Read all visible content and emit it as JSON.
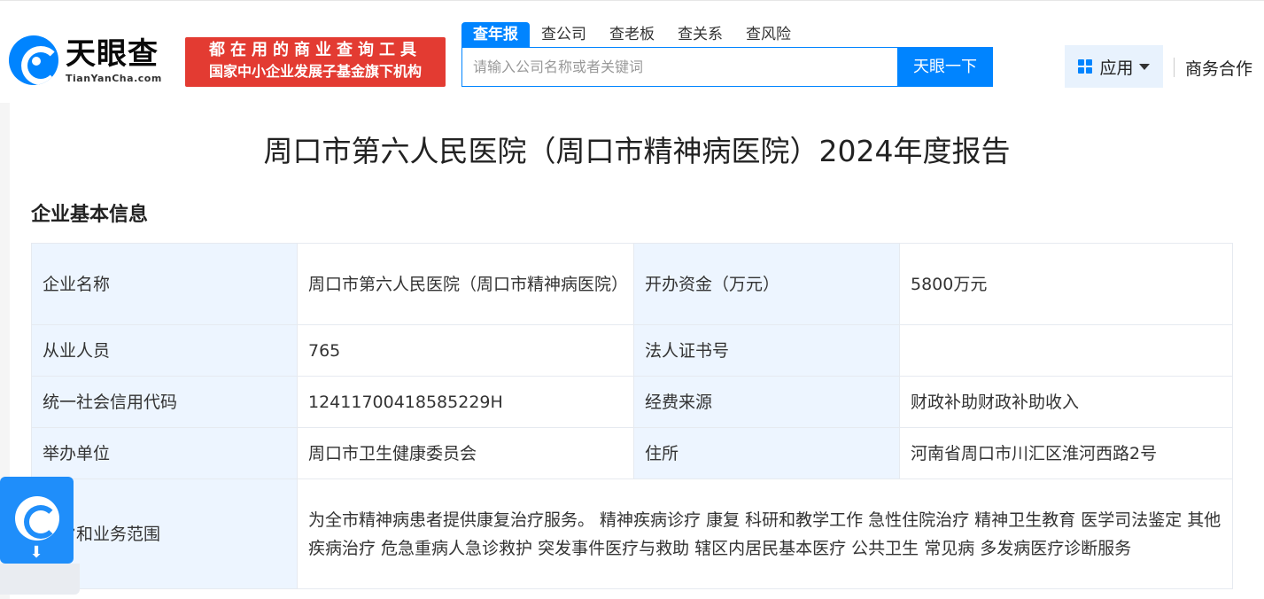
{
  "logo": {
    "cn": "天眼查",
    "en": "TianYanCha.com"
  },
  "slogan": {
    "line1": "都在用的商业查询工具",
    "line2": "国家中小企业发展子基金旗下机构"
  },
  "search": {
    "tabs": [
      "查年报",
      "查公司",
      "查老板",
      "查关系",
      "查风险"
    ],
    "active_tab": "查年报",
    "placeholder": "请输入公司名称或者关键词",
    "button": "天眼一下"
  },
  "nav": {
    "apps": "应用",
    "business": "商务合作"
  },
  "report": {
    "title": "周口市第六人民医院（周口市精神病医院）2024年度报告",
    "section": "企业基本信息",
    "rows": [
      [
        "企业名称",
        "周口市第六人民医院（周口市精神病医院）",
        "开办资金（万元）",
        "5800万元"
      ],
      [
        "从业人员",
        "765",
        "法人证书号",
        ""
      ],
      [
        "统一社会信用代码",
        "12411700418585229H",
        "经费来源",
        "财政补助财政补助收入"
      ],
      [
        "举办单位",
        "周口市卫生健康委员会",
        "住所",
        "河南省周口市川汇区淮河西路2号"
      ]
    ],
    "scope_label": "宗旨和业务范围",
    "scope_value": "为全市精神病患者提供康复治疗服务。 精神疾病诊疗 康复 科研和教学工作 急性住院治疗 精神卫生教育 医学司法鉴定 其他疾病治疗 危急重病人急诊救护 突发事件医疗与救助 辖区内居民基本医疗 公共卫生 常见病 多发病医疗诊断服务"
  },
  "colors": {
    "accent": "#0084ff",
    "slogan_bg": "#e33b32",
    "label_bg": "#edf5ff"
  }
}
